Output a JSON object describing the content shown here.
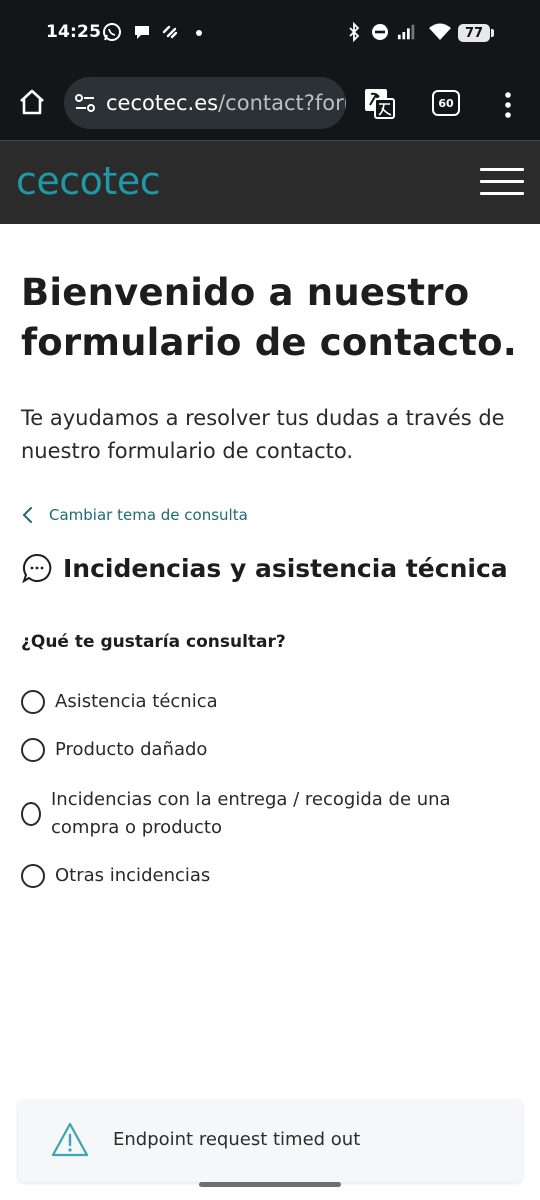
{
  "status_bar": {
    "time": "14:25",
    "battery": "77"
  },
  "browser": {
    "url_domain": "cecotec.es",
    "url_path": "/contact?form",
    "tab_count": "60"
  },
  "site": {
    "logo_text": "cecotec",
    "brand_color": "#1e9aa6"
  },
  "page": {
    "title": "Bienvenido a nuestro formulario de contacto.",
    "intro": "Te ayudamos a resolver tus dudas a través de nuestro formulario de contacto.",
    "back_link": "Cambiar tema de consulta",
    "section_title": "Incidencias y asistencia técnica",
    "question": "¿Qué te gustaría consultar?",
    "options": [
      {
        "label": "Asistencia técnica"
      },
      {
        "label": "Producto dañado"
      },
      {
        "label": "Incidencias con la entrega / recogida de una compra o producto"
      },
      {
        "label": "Otras incidencias"
      }
    ]
  },
  "toast": {
    "message": "Endpoint request timed out",
    "icon": "warning-icon"
  }
}
